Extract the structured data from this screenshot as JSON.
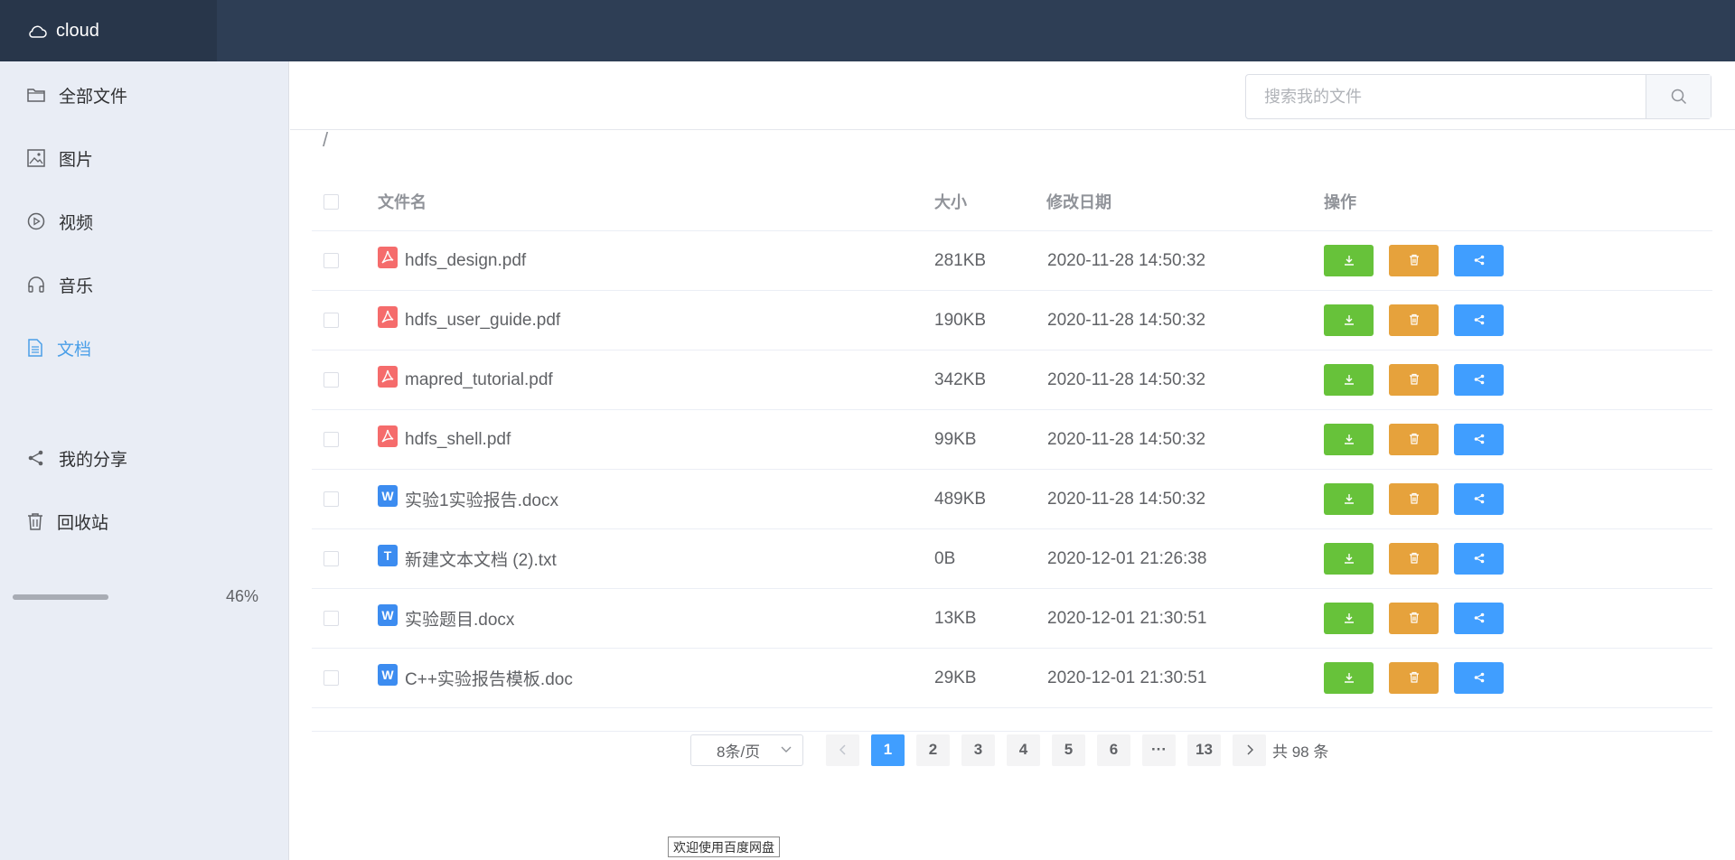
{
  "app": {
    "title": "cloud"
  },
  "sidebar": {
    "items": [
      {
        "label": "全部文件",
        "icon": "folder-icon"
      },
      {
        "label": "图片",
        "icon": "image-icon"
      },
      {
        "label": "视频",
        "icon": "video-icon"
      },
      {
        "label": "音乐",
        "icon": "headphones-icon"
      },
      {
        "label": "文档",
        "icon": "document-icon",
        "active": true
      },
      {
        "label": "我的分享",
        "icon": "share-icon"
      },
      {
        "label": "回收站",
        "icon": "trash-icon"
      }
    ],
    "quota": {
      "fraction": 0.46,
      "percent_label": "46%"
    }
  },
  "search": {
    "placeholder": "搜索我的文件",
    "value": ""
  },
  "breadcrumb": "/",
  "table": {
    "headers": {
      "name": "文件名",
      "size": "大小",
      "modified": "修改日期",
      "actions": "操作"
    },
    "rows": [
      {
        "name": "hdfs_design.pdf",
        "type": "pdf",
        "size": "281KB",
        "modified": "2020-11-28 14:50:32"
      },
      {
        "name": "hdfs_user_guide.pdf",
        "type": "pdf",
        "size": "190KB",
        "modified": "2020-11-28 14:50:32"
      },
      {
        "name": "mapred_tutorial.pdf",
        "type": "pdf",
        "size": "342KB",
        "modified": "2020-11-28 14:50:32"
      },
      {
        "name": "hdfs_shell.pdf",
        "type": "pdf",
        "size": "99KB",
        "modified": "2020-11-28 14:50:32"
      },
      {
        "name": "实验1实验报告.docx",
        "type": "word",
        "size": "489KB",
        "modified": "2020-11-28 14:50:32"
      },
      {
        "name": "新建文本文档 (2).txt",
        "type": "txt",
        "size": "0B",
        "modified": "2020-12-01 21:26:38"
      },
      {
        "name": "实验题目.docx",
        "type": "word",
        "size": "13KB",
        "modified": "2020-12-01 21:30:51"
      },
      {
        "name": "C++实验报告模板.doc",
        "type": "word",
        "size": "29KB",
        "modified": "2020-12-01 21:30:51"
      }
    ]
  },
  "pagination": {
    "page_size_label": "8条/页",
    "pages": [
      "1",
      "2",
      "3",
      "4",
      "5",
      "6",
      "···",
      "13"
    ],
    "current": "1",
    "total_label": "共 98 条"
  },
  "tooltip": "欢迎使用百度网盘",
  "colors": {
    "topbar": "#2e3e55",
    "sidebar": "#e9edf5",
    "accent": "#409eff",
    "download": "#67c23a",
    "delete": "#e6a23c",
    "share": "#409eff",
    "pdf": "#f56c6c",
    "word": "#3c8cf0"
  }
}
